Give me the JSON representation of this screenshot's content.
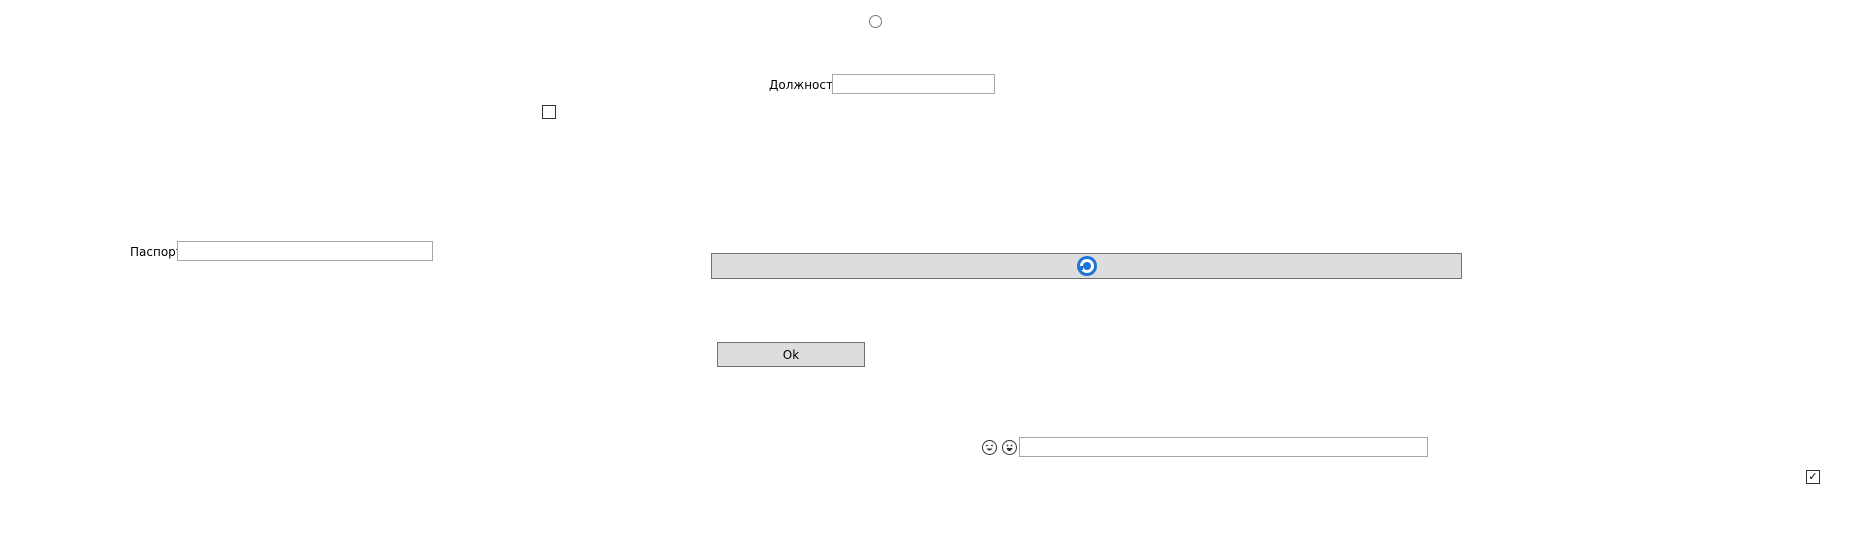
{
  "radio_button": {
    "checked": false
  },
  "position_field": {
    "label": "Должность",
    "value": ""
  },
  "checkbox_top": {
    "checked": false
  },
  "passport_field": {
    "label": "Паспорт",
    "value": ""
  },
  "wide_button": {
    "icon": "refresh-icon"
  },
  "ok_button": {
    "label": "Ok"
  },
  "emoji_row": {
    "icons": [
      "laughing-face-icon",
      "grinning-face-icon"
    ],
    "input_value": ""
  },
  "checkbox_bottom": {
    "checked": true,
    "mark": "✓"
  }
}
